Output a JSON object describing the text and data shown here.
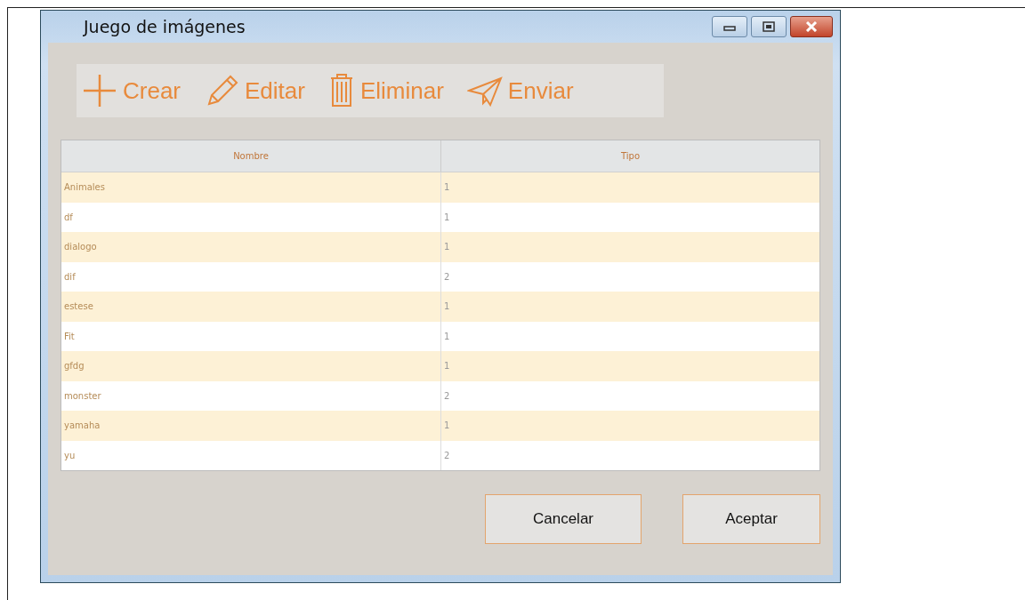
{
  "window": {
    "title": "Juego de imágenes"
  },
  "title_buttons": [
    {
      "kind": "minimize"
    },
    {
      "kind": "maximize"
    },
    {
      "kind": "close"
    }
  ],
  "toolbar": [
    {
      "kind": "plus",
      "label": "Crear"
    },
    {
      "kind": "pencil",
      "label": "Editar"
    },
    {
      "kind": "trash",
      "label": "Eliminar"
    },
    {
      "kind": "plane",
      "label": "Enviar"
    }
  ],
  "table": {
    "columns": [
      "Nombre",
      "Tipo"
    ],
    "rows": [
      [
        "Animales",
        "1"
      ],
      [
        "df",
        "1"
      ],
      [
        "dialogo",
        "1"
      ],
      [
        "dif",
        "2"
      ],
      [
        "estese",
        "1"
      ],
      [
        "Fit",
        "1"
      ],
      [
        "gfdg",
        "1"
      ],
      [
        "monster",
        "2"
      ],
      [
        "yamaha",
        "1"
      ],
      [
        "yu",
        "2"
      ]
    ]
  },
  "buttons": [
    "Cancelar",
    "Aceptar"
  ]
}
